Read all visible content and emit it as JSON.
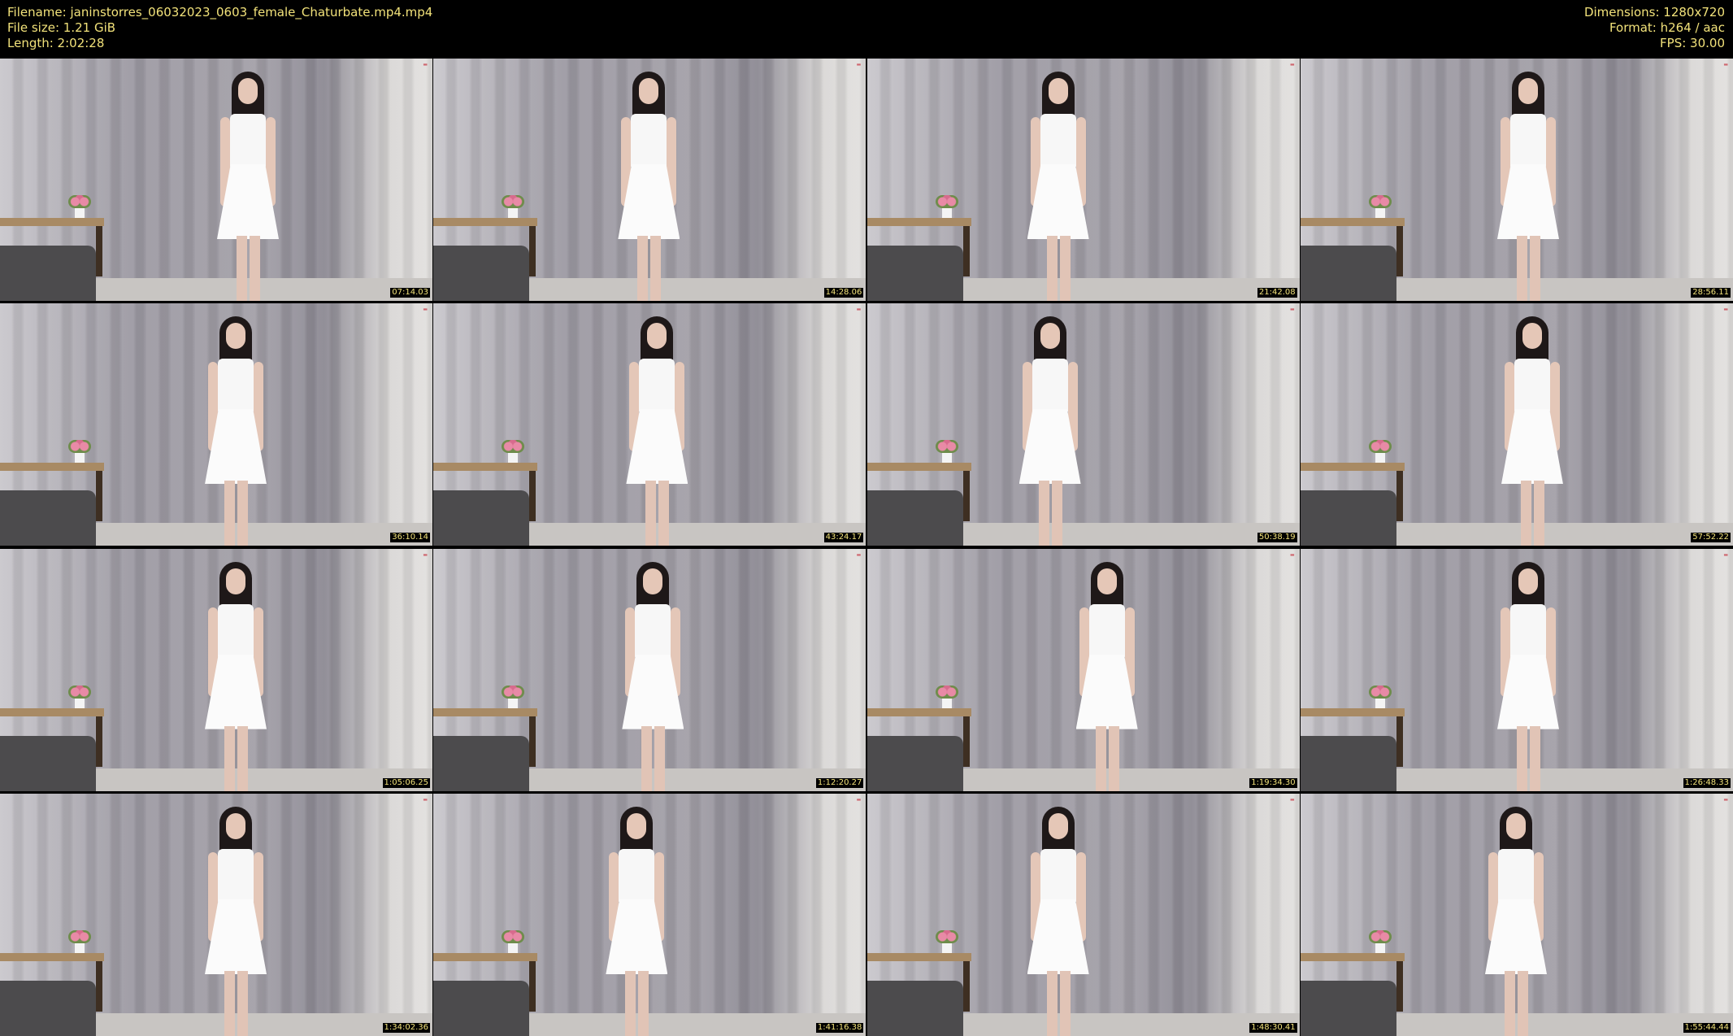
{
  "header": {
    "filename_line": "Filename: janinstorres_06032023_0603_female_Chaturbate.mp4.mp4",
    "filesize_line": "File size: 1.21 GiB",
    "length_line": "Length: 2:02:28",
    "dimensions_line": "Dimensions: 1280x720",
    "format_line": "Format: h264 / aac",
    "fps_line": "FPS: 30.00"
  },
  "thumbnails": [
    {
      "timestamp": "07:14.03"
    },
    {
      "timestamp": "14:28.06"
    },
    {
      "timestamp": "21:42.08"
    },
    {
      "timestamp": "28:56.11"
    },
    {
      "timestamp": "36:10.14"
    },
    {
      "timestamp": "43:24.17"
    },
    {
      "timestamp": "50:38.19"
    },
    {
      "timestamp": "57:52.22"
    },
    {
      "timestamp": "1:05:06.25"
    },
    {
      "timestamp": "1:12:20.27"
    },
    {
      "timestamp": "1:19:34.30"
    },
    {
      "timestamp": "1:26:48.33"
    },
    {
      "timestamp": "1:34:02.36"
    },
    {
      "timestamp": "1:41:16.38"
    },
    {
      "timestamp": "1:48:30.41"
    },
    {
      "timestamp": "1:55:44.44"
    }
  ],
  "colors": {
    "background": "#000000",
    "text": "#f2e27a"
  }
}
